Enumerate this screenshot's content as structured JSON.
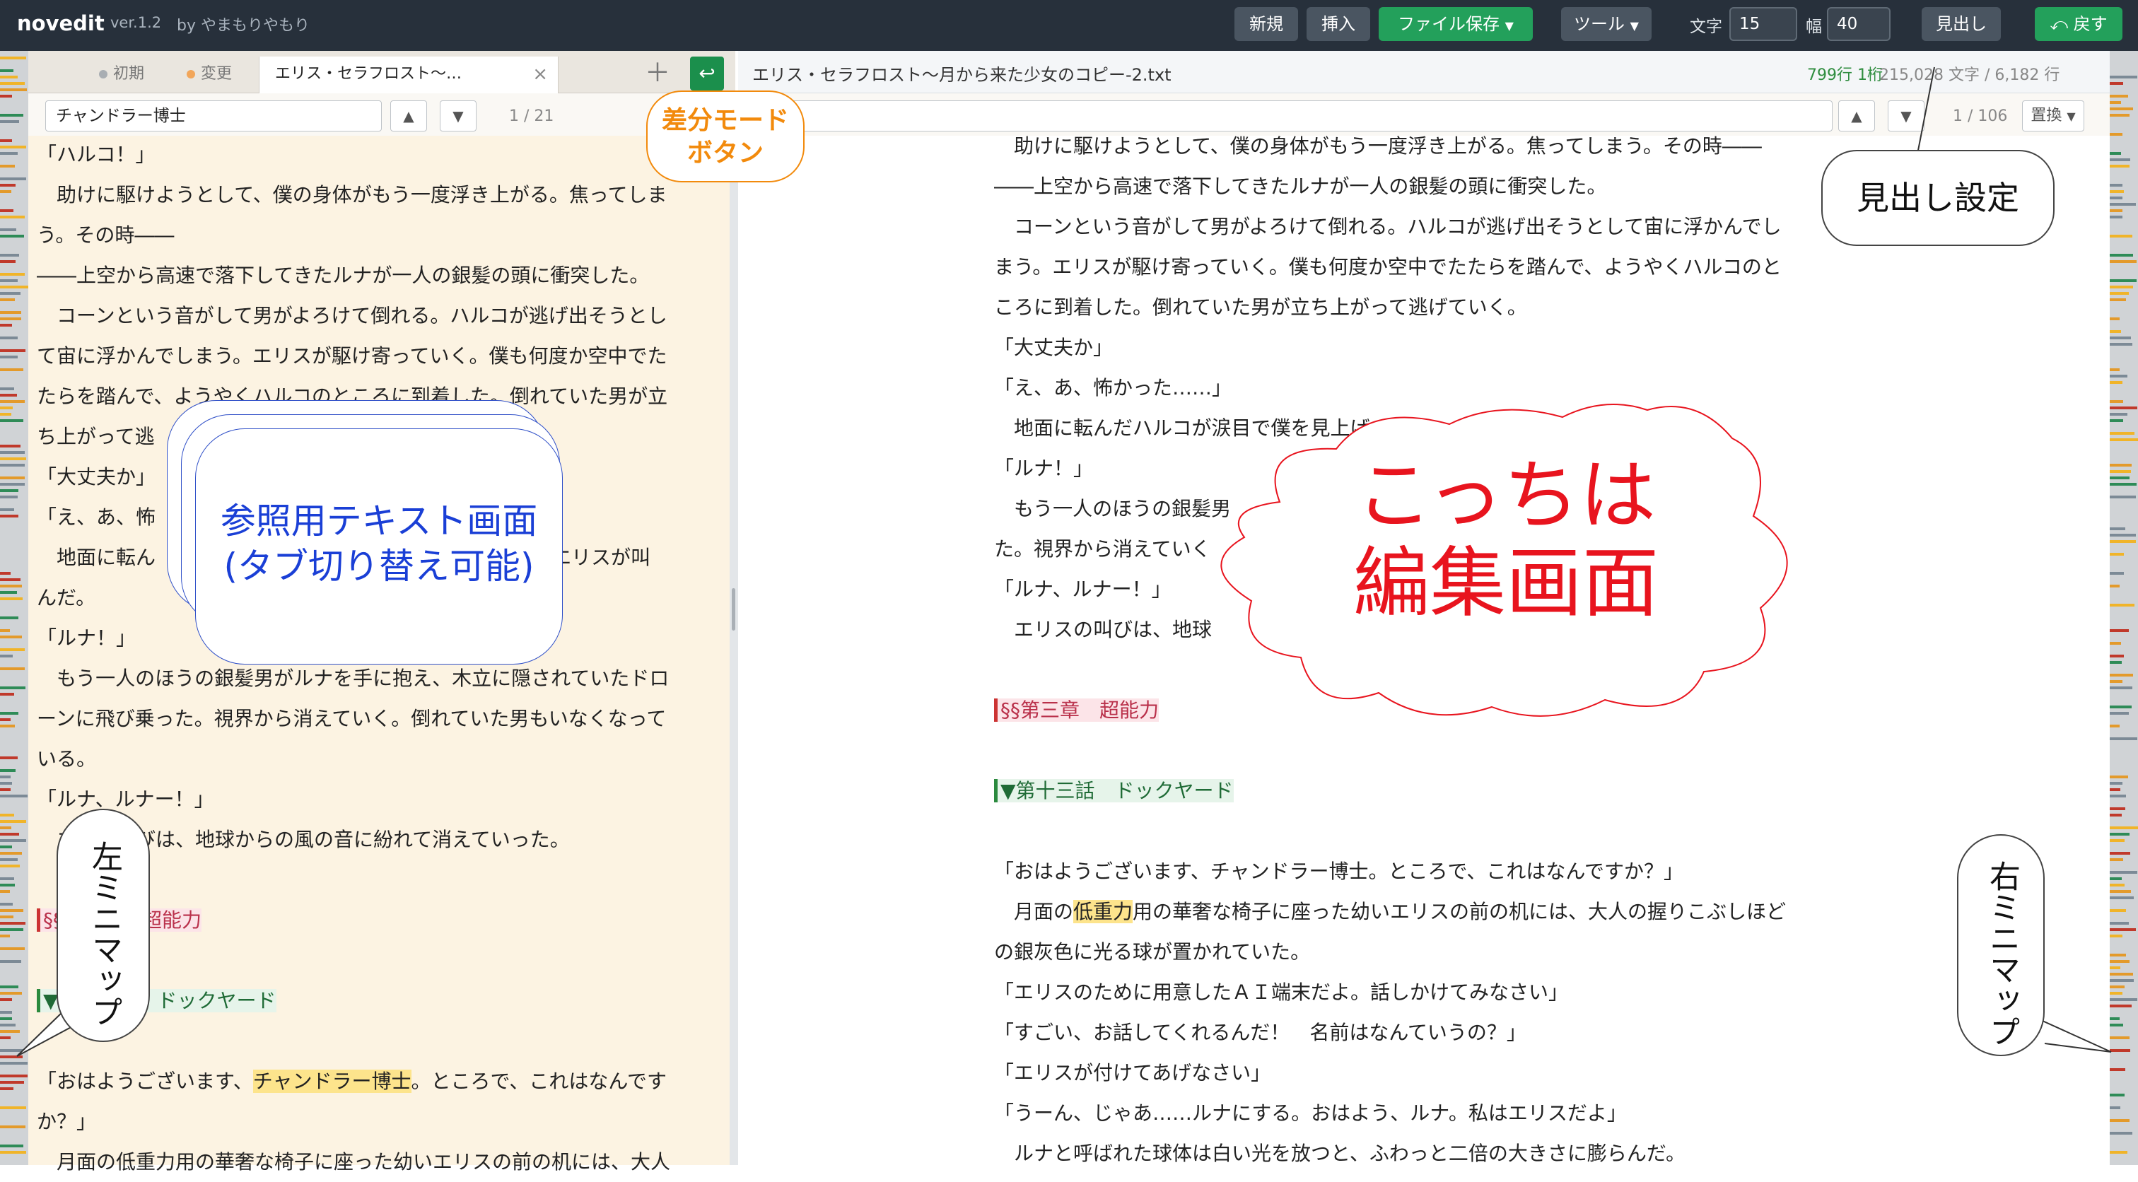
{
  "topbar": {
    "brand": "novedit",
    "version": "ver.1.2",
    "author": "by やまもりやもり",
    "new_label": "新規",
    "insert_label": "挿入",
    "save_label": "ファイル保存",
    "tools_label": "ツール",
    "chars_label": "文字",
    "chars_value": "15",
    "width_label": "幅",
    "width_value": "40",
    "heading_label": "見出し",
    "back_label": "戻す"
  },
  "left": {
    "tabs": [
      {
        "label": "初期",
        "dot": "#a9aeb3"
      },
      {
        "label": "変更",
        "dot": "#f2a65a"
      },
      {
        "label": "エリス・セラフロスト〜…",
        "close": "×"
      }
    ],
    "add_tab": "＋",
    "diff_icon": "↩",
    "search_value": "チャンドラー博士",
    "search_up": "▲",
    "search_down": "▼",
    "search_count": "1 / 21",
    "lines": [
      "「ハルコ！」",
      "　助けに駆けようとして、僕の身体がもう一度浮き上がる。焦ってしま",
      "う。その時――",
      "――上空から高速で落下してきたルナが一人の銀髪の頭に衝突した。",
      "　コーンという音がして男がよろけて倒れる。ハルコが逃げ出そうとし",
      "て宙に浮かんでしまう。エリスが駆け寄っていく。僕も何度か空中でた",
      "たらを踏んで、ようやくハルコのところに到着した。倒れていた男が立",
      "ち上がって逃",
      "「大丈夫か」",
      "「え、あ、怖",
      "　地面に転ん　　　　　　　　　　　　　　　　　　時、エリスが叫",
      "んだ。",
      "「ルナ！」",
      "　もう一人のほうの銀髪男がルナを手に抱え、木立に隠されていたドロ",
      "ーンに飛び乗った。視界から消えていく。倒れていた男もいなくなって",
      "いる。",
      "「ルナ、ルナー！」",
      "　エ　の叫びは、地球からの風の音に紛れて消えていった。",
      "",
      "§§　　　　超能力",
      "",
      "▼　　　　　ドックヤード",
      "",
      "「おはようございます、チャンドラー博士。ところで、これはなんです",
      "か？」",
      "　月面の低重力用の華奢な椅子に座った幼いエリスの前の机には、大人"
    ]
  },
  "right": {
    "file_title": "エリス・セラフロスト〜月から来た少女のコピー-2.txt",
    "position": "799行 1桁",
    "stats": "215,028 文字 / 6,182 行",
    "search_value": "り",
    "search_up": "▲",
    "search_down": "▼",
    "search_count": "1 / 106",
    "replace_label": "置換",
    "lines": [
      "　助けに駆けようとして、僕の身体がもう一度浮き上がる。焦ってしまう。その時――",
      "――上空から高速で落下してきたルナが一人の銀髪の頭に衝突した。",
      "　コーンという音がして男がよろけて倒れる。ハルコが逃げ出そうとして宙に浮かんでし",
      "まう。エリスが駆け寄っていく。僕も何度か空中でたたらを踏んで、ようやくハルコのと",
      "ころに到着した。倒れていた男が立ち上がって逃げていく。",
      "「大丈夫か」",
      "「え、あ、怖かった……」",
      "　地面に転んだハルコが涙目で僕を見上げ　　　　　　　　　　　　叫んだ。",
      "「ルナ！」",
      "　もう一人のほうの銀髪男　　　　　　　　　　　　　　　　　　　飛び乗っ",
      "た。視界から消えていく",
      "「ルナ、ルナー！」",
      "　エリスの叫びは、地球",
      "",
      "§§第三章　超能力",
      "",
      "▼第十三話　ドックヤード",
      "",
      "「おはようございます、チャンドラー博士。ところで、これはなんですか？」",
      "　月面の低重力用の華奢な椅子に座った幼いエリスの前の机には、大人の握りこぶしほど",
      "の銀灰色に光る球が置かれていた。",
      "「エリスのために用意したＡＩ端末だよ。話しかけてみなさい」",
      "「すごい、お話してくれるんだ！　名前はなんていうの？」",
      "「エリスが付けてあげなさい」",
      "「うーん、じゃあ……ルナにする。おはよう、ルナ。私はエリスだよ」",
      "　ルナと呼ばれた球体は白い光を放つと、ふわっと二倍の大きさに膨らんだ。"
    ]
  },
  "annotations": {
    "diff_mode": "差分モード\nボタン",
    "heading_setting": "見出し設定",
    "reference_screen": "参照用テキスト画面\n(タブ切り替え可能)",
    "edit_screen": "こっちは\n編集画面",
    "left_minimap": "左ミニマップ",
    "right_minimap": "右ミニマップ"
  },
  "colors": {
    "topbar": "#27303b",
    "reference_bg": "#fcf3e2",
    "accent_green": "#23a05b",
    "annotation_blue": "#1a3fd6",
    "annotation_red": "#e8141e",
    "annotation_orange": "#f28a0c"
  }
}
